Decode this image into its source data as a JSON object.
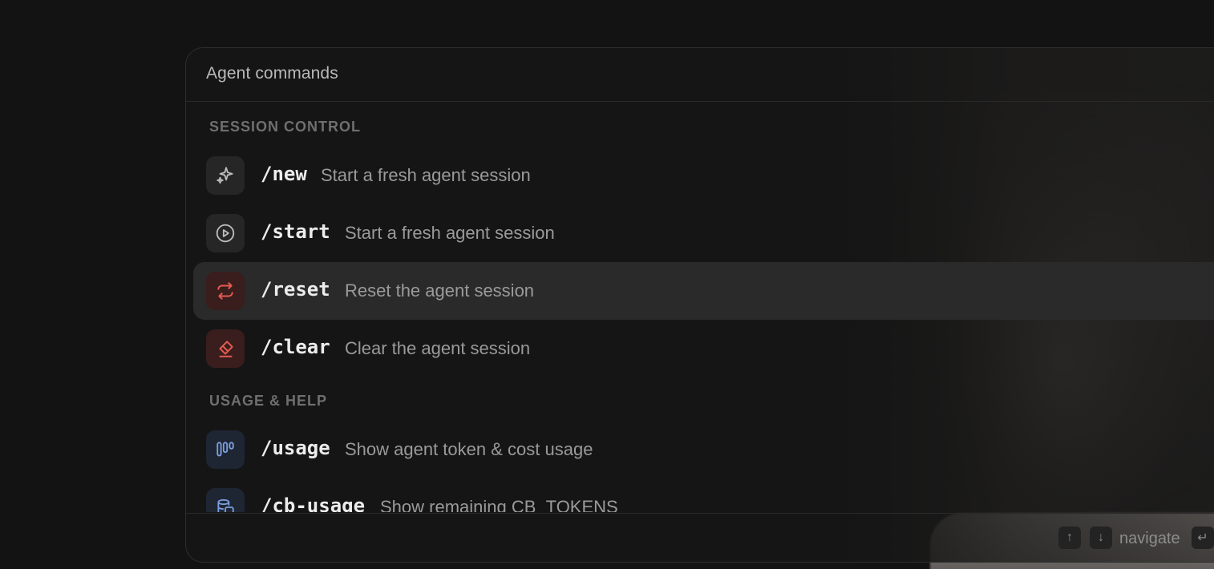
{
  "palette": {
    "title": "Agent commands"
  },
  "sections": [
    {
      "label": "SESSION CONTROL",
      "items": [
        {
          "command": "/new",
          "description": "Start a fresh agent session",
          "icon": "sparkles-icon"
        },
        {
          "command": "/start",
          "description": "Start a fresh agent session",
          "icon": "play-circle-icon"
        },
        {
          "command": "/reset",
          "description": "Reset the agent session",
          "icon": "refresh-icon",
          "selected": true
        },
        {
          "command": "/clear",
          "description": "Clear the agent session",
          "icon": "eraser-icon"
        }
      ]
    },
    {
      "label": "USAGE & HELP",
      "items": [
        {
          "command": "/usage",
          "description": "Show agent token & cost usage",
          "icon": "bar-chart-icon"
        },
        {
          "command": "/cb-usage",
          "description": "Show remaining CB_TOKENS",
          "icon": "database-icon"
        }
      ]
    }
  ],
  "footer": {
    "up_key": "↑",
    "down_key": "↓",
    "navigate_label": "navigate",
    "enter_key": "↵"
  },
  "colors": {
    "accent_red": "#e25c4f",
    "accent_blue": "#7c9fe0",
    "selected_row": "#2a2a2a"
  }
}
